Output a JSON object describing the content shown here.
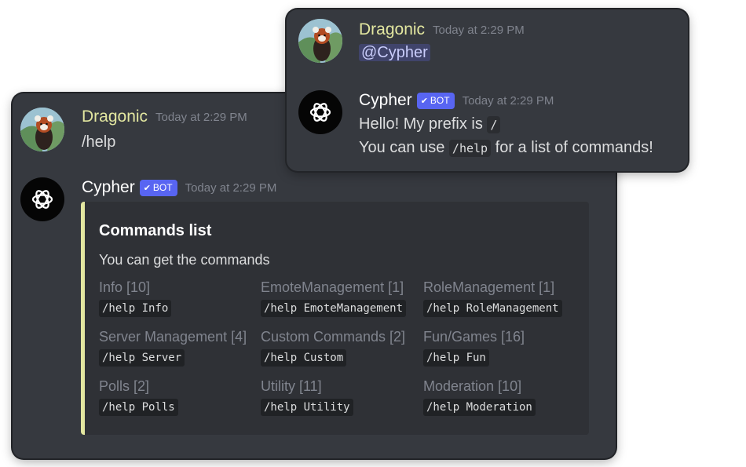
{
  "back_chat": {
    "user_message": {
      "author": "Dragonic",
      "timestamp": "Today at 2:29 PM",
      "content": "/help"
    },
    "bot_message": {
      "author": "Cypher",
      "badge": "BOT",
      "timestamp": "Today at 2:29 PM",
      "embed": {
        "title": "Commands list",
        "description": "You can get the commands",
        "fields": [
          {
            "name": "Info [10]",
            "value": "/help Info"
          },
          {
            "name": "EmoteManagement [1]",
            "value": "/help EmoteManagement"
          },
          {
            "name": "RoleManagement [1]",
            "value": "/help RoleManagement"
          },
          {
            "name": "Server Management [4]",
            "value": "/help Server"
          },
          {
            "name": "Custom Commands [2]",
            "value": "/help Custom"
          },
          {
            "name": "Fun/Games [16]",
            "value": "/help Fun"
          },
          {
            "name": "Polls [2]",
            "value": "/help Polls"
          },
          {
            "name": "Utility [11]",
            "value": "/help Utility"
          },
          {
            "name": "Moderation [10]",
            "value": "/help Moderation"
          }
        ]
      }
    }
  },
  "front_chat": {
    "user_message": {
      "author": "Dragonic",
      "timestamp": "Today at 2:29 PM",
      "mention": "@Cypher"
    },
    "bot_message": {
      "author": "Cypher",
      "badge": "BOT",
      "timestamp": "Today at 2:29 PM",
      "line1_text": "Hello! My prefix is",
      "line1_code": "/",
      "line2_text_before": "You can use",
      "line2_code": "/help",
      "line2_text_after": "for a list of commands!"
    }
  },
  "colors": {
    "panel_bg": "#36393f",
    "embed_bg": "#2f3136",
    "embed_accent": "#e3e7a0",
    "username_user": "#e3e7a0",
    "badge_bg": "#5865f2",
    "mention_bg": "#40446b"
  },
  "icons": {
    "user_avatar": "red-panda-avatar",
    "bot_avatar": "openai-logo-avatar",
    "verified": "check-icon"
  }
}
